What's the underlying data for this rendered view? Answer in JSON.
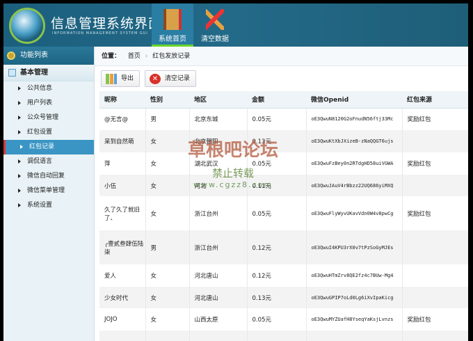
{
  "header": {
    "title": "信息管理系统界面",
    "subtitle": "INFORMATION MANAGEMENT SYSTEM GUI",
    "nav": [
      {
        "label": "系统首页",
        "active": true
      },
      {
        "label": "清空数据",
        "active": false
      }
    ]
  },
  "sidebar": {
    "title": "功能列表",
    "group": "基本管理",
    "items": [
      {
        "label": "公共信息"
      },
      {
        "label": "用户列表"
      },
      {
        "label": "公众号管理"
      },
      {
        "label": "红包设置"
      },
      {
        "label": "红包记录",
        "active": true
      },
      {
        "label": "调侃语言"
      },
      {
        "label": "微信自动回复"
      },
      {
        "label": "微信菜单管理"
      },
      {
        "label": "系统设置"
      }
    ]
  },
  "breadcrumb": {
    "label": "位置：",
    "home": "首页",
    "current": "红包发放记录"
  },
  "toolbar": {
    "export": "导出",
    "clear": "清空记录"
  },
  "table": {
    "headers": [
      "昵称",
      "性别",
      "地区",
      "金额",
      "微信Openid",
      "红包来源"
    ],
    "rows": [
      [
        "@无言@",
        "男",
        "北京东城",
        "0.05元",
        "oE3QwuN8120G2oFnudN56ftj33Mc",
        "奖励红包"
      ],
      [
        "呆到自然萌",
        "女",
        "北京朝阳",
        "0.13元",
        "oE3QwuKtXbJXizeB-zNaQQGT6ujs",
        ""
      ],
      [
        "萍",
        "女",
        "湖北武汉",
        "0.05元",
        "oE3QwuFzBey0n2RTdgHD58uiVGWA",
        "奖励红包"
      ],
      [
        "小伍",
        "女",
        "河北",
        "0.11元",
        "oE3QwuJAuV4rBbzz22UQ686yiMXQ",
        ""
      ],
      [
        "久了久了就旧了、",
        "女",
        "浙江台州",
        "0.05元",
        "oE3QwuFlyWyvUKavVdn0W4v8pwCg",
        "奖励红包"
      ],
      [
        "╭壹贰叁肆伍陆柒",
        "男",
        "浙江台州",
        "0.12元",
        "oE3QwuI4KPU3rX0v7tPzSoGyMJEs",
        ""
      ],
      [
        "爱人",
        "女",
        "河北唐山",
        "0.12元",
        "oE3QwuHTmZrv8QE2fz4c7BUw-Mg4",
        ""
      ],
      [
        "少女时代",
        "女",
        "河北唐山",
        "0.13元",
        "oE3QwuGPIP7oLd0Lg6iXvIpaKicg",
        ""
      ],
      [
        "JOJO",
        "女",
        "山西太原",
        "0.05元",
        "oE3QwuMYZUafH8YseqYaKsjLvnzs",
        "奖励红包"
      ]
    ]
  },
  "watermark": {
    "line1": "草根吧论坛",
    "line2": "禁止转载",
    "line3": "www.cgzz8.com"
  }
}
